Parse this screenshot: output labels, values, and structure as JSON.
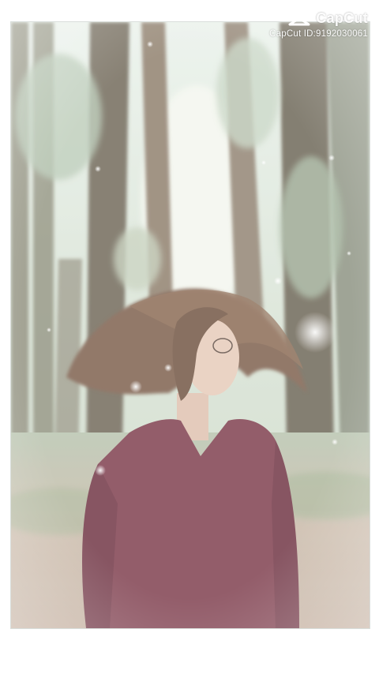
{
  "watermark": {
    "brand": "CapCut",
    "id_text": "CapCut ID:9192030061",
    "logo_icon": "capcut-logo-icon"
  },
  "photo": {
    "palette": {
      "sky": "#e8efe6",
      "trees": "#6f6b5a",
      "foliage": "#9fb39b",
      "ground": "#c7b3a3",
      "sweater": "#7c3a4a",
      "hair": "#7a5a47",
      "skin": "#e5c8b7"
    }
  }
}
